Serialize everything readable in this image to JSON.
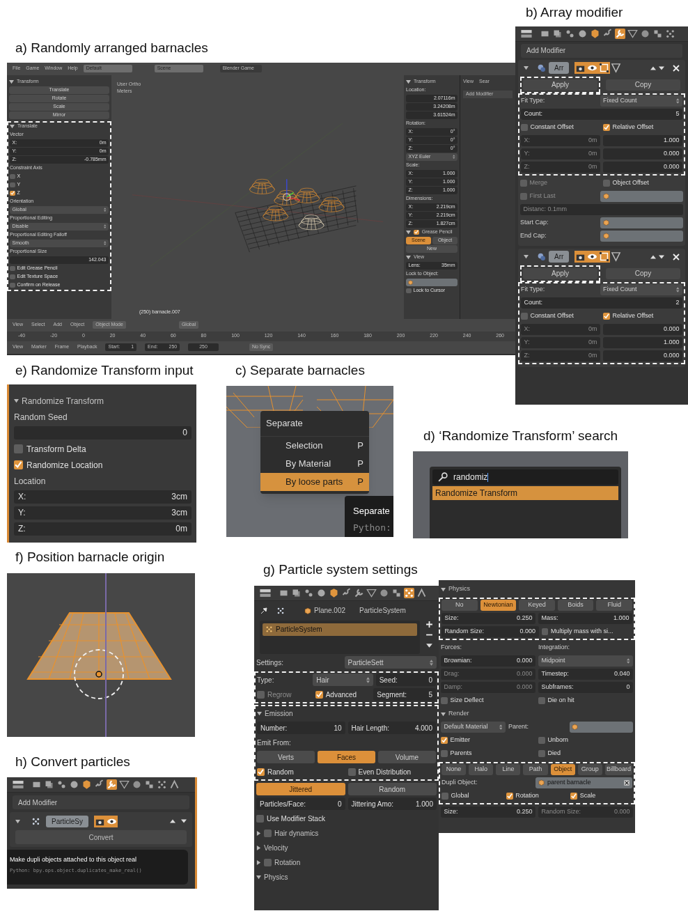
{
  "panel_a": {
    "caption": "a) Randomly arranged barnacles",
    "top_menu": [
      "File",
      "Game",
      "Window",
      "Help"
    ],
    "layout_field": "Default",
    "scene_field": "Scene",
    "engine_field": "Blender Game",
    "tool_shelf": [
      {
        "outlined": false,
        "rows": [
          {
            "items": [
              {
                "kind": "header",
                "label": "Transform",
                "expanded": true
              }
            ]
          },
          {
            "items": [
              {
                "kind": "button",
                "label": "Translate",
                "selected": false
              }
            ]
          },
          {
            "items": [
              {
                "kind": "button",
                "label": "Rotate",
                "selected": false
              }
            ]
          },
          {
            "items": [
              {
                "kind": "button",
                "label": "Scale",
                "selected": false
              }
            ]
          },
          {
            "items": [
              {
                "kind": "button",
                "label": "Mirror",
                "selected": false
              }
            ]
          }
        ]
      },
      {
        "outlined": true,
        "rows": [
          {
            "items": [
              {
                "kind": "header",
                "label": "Translate",
                "expanded": true
              }
            ]
          },
          {
            "items": [
              {
                "kind": "text",
                "label": "Vector"
              }
            ]
          },
          {
            "items": [
              {
                "kind": "field",
                "label": "X:",
                "value": "0m",
                "disabled": false
              }
            ]
          },
          {
            "items": [
              {
                "kind": "field",
                "label": "Y:",
                "value": "0m",
                "disabled": false
              }
            ]
          },
          {
            "items": [
              {
                "kind": "field",
                "label": "Z:",
                "value": "-0.785mm",
                "disabled": false
              }
            ]
          },
          {
            "items": [
              {
                "kind": "text",
                "label": "Constraint Axis"
              }
            ]
          },
          {
            "items": [
              {
                "kind": "check",
                "label": "X",
                "checked": false,
                "disabled": false
              }
            ]
          },
          {
            "items": [
              {
                "kind": "check",
                "label": "Y",
                "checked": false,
                "disabled": false
              }
            ]
          },
          {
            "items": [
              {
                "kind": "check",
                "label": "Z",
                "checked": true,
                "disabled": false
              }
            ]
          },
          {
            "items": [
              {
                "kind": "text",
                "label": "Orientation"
              }
            ]
          },
          {
            "items": [
              {
                "kind": "select",
                "label": "Global"
              }
            ]
          },
          {
            "items": [
              {
                "kind": "text",
                "label": "Proportional Editing"
              }
            ]
          },
          {
            "items": [
              {
                "kind": "select",
                "label": "Disable"
              }
            ]
          },
          {
            "items": [
              {
                "kind": "text",
                "label": "Proportional Editing Falloff"
              }
            ]
          },
          {
            "items": [
              {
                "kind": "select",
                "label": "Smooth"
              }
            ]
          },
          {
            "items": [
              {
                "kind": "text",
                "label": "Proportional Size"
              }
            ]
          },
          {
            "items": [
              {
                "kind": "field",
                "value": "142.043",
                "disabled": false
              }
            ]
          },
          {
            "items": [
              {
                "kind": "check",
                "label": "Edit Grease Pencil",
                "checked": false,
                "disabled": false
              }
            ]
          },
          {
            "items": [
              {
                "kind": "check",
                "label": "Edit Texture Space",
                "checked": false,
                "disabled": false
              }
            ]
          },
          {
            "items": [
              {
                "kind": "check",
                "label": "Confirm on Release",
                "checked": false,
                "disabled": false
              }
            ]
          }
        ]
      }
    ],
    "viewport": {
      "view_name": "User Ortho",
      "units": "Meters",
      "object_label": "(250) barnacle.007"
    },
    "n_panel": [
      {
        "outlined": false,
        "rows": [
          {
            "items": [
              {
                "kind": "header",
                "label": "Transform",
                "expanded": true
              }
            ]
          },
          {
            "items": [
              {
                "kind": "text",
                "label": "Location:"
              }
            ]
          },
          {
            "items": [
              {
                "kind": "field",
                "value": "2.07116m",
                "disabled": false
              }
            ]
          },
          {
            "items": [
              {
                "kind": "field",
                "value": "3.24208m",
                "disabled": false
              }
            ]
          },
          {
            "items": [
              {
                "kind": "field",
                "value": "3.61524m",
                "disabled": false
              }
            ]
          },
          {
            "items": [
              {
                "kind": "text",
                "label": "Rotation:"
              }
            ]
          },
          {
            "items": [
              {
                "kind": "field",
                "label": "X:",
                "value": "0°",
                "disabled": false
              }
            ]
          },
          {
            "items": [
              {
                "kind": "field",
                "label": "Y:",
                "value": "0°",
                "disabled": false
              }
            ]
          },
          {
            "items": [
              {
                "kind": "field",
                "label": "Z:",
                "value": "0°",
                "disabled": false
              }
            ]
          },
          {
            "items": [
              {
                "kind": "select",
                "label": "XYZ Euler"
              }
            ]
          },
          {
            "items": [
              {
                "kind": "text",
                "label": "Scale:"
              }
            ]
          },
          {
            "items": [
              {
                "kind": "field",
                "label": "X:",
                "value": "1.000",
                "disabled": false
              }
            ]
          },
          {
            "items": [
              {
                "kind": "field",
                "label": "Y:",
                "value": "1.000",
                "disabled": false
              }
            ]
          },
          {
            "items": [
              {
                "kind": "field",
                "label": "Z:",
                "value": "1.000",
                "disabled": false
              }
            ]
          },
          {
            "items": [
              {
                "kind": "text",
                "label": "Dimensions:"
              }
            ]
          },
          {
            "items": [
              {
                "kind": "field",
                "label": "X:",
                "value": "2.219cm",
                "disabled": false
              }
            ]
          },
          {
            "items": [
              {
                "kind": "field",
                "label": "Y:",
                "value": "2.219cm",
                "disabled": false
              }
            ]
          },
          {
            "items": [
              {
                "kind": "field",
                "label": "Z:",
                "value": "1.827cm",
                "disabled": false
              }
            ]
          },
          {
            "items": [
              {
                "kind": "header",
                "label": "Grease Pencil",
                "expanded": true,
                "checked": true
              }
            ]
          },
          {
            "items": [
              {
                "kind": "button",
                "label": "Scene",
                "selected": true
              },
              {
                "kind": "button",
                "label": "Object",
                "selected": false
              }
            ]
          },
          {
            "items": [
              {
                "kind": "button",
                "label": "New",
                "selected": false
              }
            ]
          },
          {
            "items": [
              {
                "kind": "header",
                "label": "View",
                "expanded": true
              }
            ]
          },
          {
            "items": [
              {
                "kind": "field",
                "label": "Lens:",
                "value": "35mm",
                "disabled": false
              }
            ]
          },
          {
            "items": [
              {
                "kind": "text",
                "label": "Lock to Object:"
              }
            ]
          },
          {
            "items": [
              {
                "kind": "object"
              }
            ]
          },
          {
            "items": [
              {
                "kind": "check",
                "label": "Lock to Cursor",
                "checked": false,
                "disabled": false
              }
            ]
          }
        ]
      }
    ],
    "side_tabs": [
      "View",
      "Sear"
    ],
    "side_add_modifier": "Add Modifier",
    "view_header": {
      "menus": [
        "View",
        "Select",
        "Add",
        "Object"
      ],
      "mode": "Object Mode",
      "orientation": "Global"
    },
    "timeline_ticks": [
      "-40",
      "-20",
      "0",
      "20",
      "40",
      "60",
      "80",
      "100",
      "120",
      "140",
      "160",
      "180",
      "200",
      "220",
      "240",
      "260"
    ],
    "timeline_header": {
      "menus": [
        "View",
        "Marker",
        "Frame",
        "Playback"
      ],
      "start": "Start:",
      "start_value": "1",
      "end": "End:",
      "end_value": "250",
      "current": "250",
      "sync": "No Sync"
    }
  },
  "panel_b": {
    "caption": "b) Array modifier",
    "tabs": [
      {
        "kind": "render",
        "selected": false
      },
      {
        "kind": "layers",
        "selected": false
      },
      {
        "kind": "scene",
        "selected": false
      },
      {
        "kind": "world",
        "selected": false
      },
      {
        "kind": "object",
        "selected": false
      },
      {
        "kind": "constraints",
        "selected": false
      },
      {
        "kind": "modifiers",
        "selected": true
      },
      {
        "kind": "data",
        "selected": false
      },
      {
        "kind": "material",
        "selected": false
      },
      {
        "kind": "texture",
        "selected": false
      },
      {
        "kind": "particles",
        "selected": false
      }
    ],
    "add_modifier": "Add Modifier",
    "modifiers": [
      {
        "name": "Arr",
        "toggles": [
          {
            "kind": "render",
            "on": true
          },
          {
            "kind": "viewport",
            "on": true
          },
          {
            "kind": "editmode",
            "on": true
          },
          {
            "kind": "cage",
            "on": false
          }
        ],
        "apply": "Apply",
        "apply_outlined": true,
        "copy": "Copy",
        "sections": [
          {
            "outlined": true,
            "rows": [
              {
                "items": [
                  {
                    "kind": "text",
                    "label": "Fit Type:"
                  },
                  {
                    "kind": "select",
                    "label": "Fixed Count"
                  }
                ]
              },
              {
                "items": [
                  {
                    "kind": "field",
                    "label": "Count:",
                    "value": "5",
                    "disabled": false
                  }
                ]
              },
              {
                "items": [
                  {
                    "kind": "check",
                    "label": "Constant Offset",
                    "checked": false,
                    "disabled": false
                  },
                  {
                    "kind": "check",
                    "label": "Relative Offset",
                    "checked": true,
                    "disabled": false
                  }
                ]
              },
              {
                "items": [
                  {
                    "kind": "field",
                    "label": "X:",
                    "value": "0m",
                    "disabled": true
                  },
                  {
                    "kind": "field",
                    "value": "1.000",
                    "disabled": false
                  }
                ]
              },
              {
                "items": [
                  {
                    "kind": "field",
                    "label": "Y:",
                    "value": "0m",
                    "disabled": true
                  },
                  {
                    "kind": "field",
                    "value": "0.000",
                    "disabled": false
                  }
                ]
              },
              {
                "items": [
                  {
                    "kind": "field",
                    "label": "Z:",
                    "value": "0m",
                    "disabled": true
                  },
                  {
                    "kind": "field",
                    "value": "0.000",
                    "disabled": false
                  }
                ]
              }
            ]
          },
          {
            "outlined": false,
            "rows": [
              {
                "items": [
                  {
                    "kind": "check",
                    "label": "Merge",
                    "checked": false,
                    "disabled": true
                  },
                  {
                    "kind": "check",
                    "label": "Object Offset",
                    "checked": false,
                    "disabled": false
                  }
                ]
              },
              {
                "items": [
                  {
                    "kind": "check",
                    "label": "First Last",
                    "checked": false,
                    "disabled": true
                  },
                  {
                    "kind": "object"
                  }
                ]
              },
              {
                "items": [
                  {
                    "kind": "field",
                    "label": "Distanc: 0.1mm",
                    "disabled": true
                  }
                ]
              },
              {
                "items": [
                  {
                    "kind": "text",
                    "label": "Start Cap:"
                  },
                  {
                    "kind": "object"
                  }
                ]
              },
              {
                "items": [
                  {
                    "kind": "text",
                    "label": "End Cap:"
                  },
                  {
                    "kind": "object"
                  }
                ]
              }
            ]
          }
        ]
      },
      {
        "name": "Arr",
        "toggles": [
          {
            "kind": "render",
            "on": true
          },
          {
            "kind": "viewport",
            "on": true
          },
          {
            "kind": "editmode",
            "on": true
          },
          {
            "kind": "cage",
            "on": false
          }
        ],
        "apply": "Apply",
        "apply_outlined": true,
        "copy": "Copy",
        "sections": [
          {
            "outlined": true,
            "rows": [
              {
                "items": [
                  {
                    "kind": "text",
                    "label": "Fit Type:"
                  },
                  {
                    "kind": "select",
                    "label": "Fixed Count"
                  }
                ]
              },
              {
                "items": [
                  {
                    "kind": "field",
                    "label": "Count:",
                    "value": "2",
                    "disabled": false
                  }
                ]
              },
              {
                "items": [
                  {
                    "kind": "check",
                    "label": "Constant Offset",
                    "checked": false,
                    "disabled": false
                  },
                  {
                    "kind": "check",
                    "label": "Relative Offset",
                    "checked": true,
                    "disabled": false
                  }
                ]
              },
              {
                "items": [
                  {
                    "kind": "field",
                    "label": "X:",
                    "value": "0m",
                    "disabled": true
                  },
                  {
                    "kind": "field",
                    "value": "0.000",
                    "disabled": false
                  }
                ]
              },
              {
                "items": [
                  {
                    "kind": "field",
                    "label": "Y:",
                    "value": "0m",
                    "disabled": true
                  },
                  {
                    "kind": "field",
                    "value": "1.000",
                    "disabled": false
                  }
                ]
              },
              {
                "items": [
                  {
                    "kind": "field",
                    "label": "Z:",
                    "value": "0m",
                    "disabled": true
                  },
                  {
                    "kind": "field",
                    "value": "0.000",
                    "disabled": false
                  }
                ]
              }
            ]
          }
        ]
      }
    ]
  },
  "panel_e": {
    "caption": "e) Randomize Transform  input",
    "sections": [
      {
        "outlined": false,
        "rows": [
          {
            "items": [
              {
                "kind": "header",
                "label": "Randomize Transform",
                "expanded": true
              }
            ]
          },
          {
            "items": [
              {
                "kind": "text",
                "label": "Random Seed"
              }
            ]
          },
          {
            "items": [
              {
                "kind": "field",
                "value": "0",
                "disabled": false
              }
            ]
          },
          {
            "items": [
              {
                "kind": "check",
                "label": "Transform Delta",
                "checked": false,
                "disabled": false
              }
            ]
          },
          {
            "items": [
              {
                "kind": "check",
                "label": "Randomize Location",
                "checked": true,
                "disabled": false
              }
            ]
          },
          {
            "items": [
              {
                "kind": "text",
                "label": "Location"
              }
            ]
          },
          {
            "items": [
              {
                "kind": "field",
                "label": "X:",
                "value": "3cm",
                "disabled": false
              }
            ]
          },
          {
            "items": [
              {
                "kind": "field",
                "label": "Y:",
                "value": "3cm",
                "disabled": false
              }
            ]
          },
          {
            "items": [
              {
                "kind": "field",
                "label": "Z:",
                "value": "0m",
                "disabled": false
              }
            ]
          }
        ]
      }
    ]
  },
  "panel_c": {
    "caption": "c) Separate barnacles",
    "menu_title": "Separate",
    "menu_items": [
      {
        "label": "Selection",
        "shortcut": "P",
        "selected": false
      },
      {
        "label": "By Material",
        "shortcut": "P",
        "selected": false
      },
      {
        "label": "By loose parts",
        "shortcut": "P",
        "selected": true
      }
    ],
    "tooltip_title": "Separate",
    "tooltip_python": "Python:"
  },
  "panel_d": {
    "caption": "d) ‘Randomize Transform’  search",
    "search_value": "randomiz",
    "results": [
      {
        "label": "Randomize Transform",
        "selected": true
      }
    ]
  },
  "panel_f": {
    "caption": "f) Position barnacle origin"
  },
  "panel_h": {
    "caption": "h) Convert  particles",
    "tabs": [
      {
        "kind": "render",
        "selected": false
      },
      {
        "kind": "layers",
        "selected": false
      },
      {
        "kind": "scene",
        "selected": false
      },
      {
        "kind": "world",
        "selected": false
      },
      {
        "kind": "object",
        "selected": false
      },
      {
        "kind": "constraints",
        "selected": false
      },
      {
        "kind": "modifiers",
        "selected": true
      },
      {
        "kind": "data",
        "selected": false
      },
      {
        "kind": "material",
        "selected": false
      },
      {
        "kind": "texture",
        "selected": false
      },
      {
        "kind": "particles",
        "selected": false
      },
      {
        "kind": "physics",
        "selected": false
      }
    ],
    "add_modifier": "Add Modifier",
    "modifier_name": "ParticleSy",
    "toggles": [
      {
        "kind": "render",
        "on": true
      },
      {
        "kind": "viewport",
        "on": true
      }
    ],
    "convert": "Convert",
    "tooltip_title": "Make dupli objects attached to this object real",
    "tooltip_python": "Python: bpy.ops.object.duplicates_make_real()"
  },
  "panel_g": {
    "caption": "g) Particle system settings",
    "tabs": [
      {
        "kind": "render",
        "selected": false
      },
      {
        "kind": "layers",
        "selected": false
      },
      {
        "kind": "scene",
        "selected": false
      },
      {
        "kind": "world",
        "selected": false
      },
      {
        "kind": "object",
        "selected": false
      },
      {
        "kind": "constraints",
        "selected": false
      },
      {
        "kind": "modifiers",
        "selected": false
      },
      {
        "kind": "data",
        "selected": false
      },
      {
        "kind": "material",
        "selected": false
      },
      {
        "kind": "texture",
        "selected": false
      },
      {
        "kind": "particles",
        "selected": true
      },
      {
        "kind": "physics",
        "selected": false
      }
    ],
    "object_name": "Plane.002",
    "system_name": "ParticleSystem",
    "list_item": "ParticleSystem",
    "left_sections": [
      {
        "outlined": false,
        "rows": [
          {
            "items": [
              {
                "kind": "text",
                "label": "Settings:"
              },
              {
                "kind": "select",
                "label": "ParticleSett"
              }
            ]
          }
        ]
      },
      {
        "outlined": true,
        "rows": [
          {
            "items": [
              {
                "kind": "text",
                "label": "Type:"
              },
              {
                "kind": "select",
                "label": "Hair"
              },
              {
                "kind": "field",
                "label": "Seed:",
                "value": "0",
                "disabled": false
              }
            ]
          },
          {
            "items": [
              {
                "kind": "check",
                "label": "Regrow",
                "checked": false,
                "disabled": true
              },
              {
                "kind": "check",
                "label": "Advanced",
                "checked": true,
                "disabled": false
              },
              {
                "kind": "field",
                "label": "Segment:",
                "value": "5",
                "disabled": false
              }
            ]
          }
        ]
      },
      {
        "outlined": true,
        "rows": [
          {
            "items": [
              {
                "kind": "header",
                "label": "Emission",
                "expanded": true
              }
            ]
          },
          {
            "items": [
              {
                "kind": "field",
                "label": "Number:",
                "value": "10",
                "disabled": false
              },
              {
                "kind": "field",
                "label": "Hair Length:",
                "value": "4.000",
                "disabled": false
              }
            ]
          },
          {
            "items": [
              {
                "kind": "text",
                "label": "Emit From:"
              }
            ]
          },
          {
            "items": [
              {
                "kind": "button",
                "label": "Verts",
                "selected": false
              },
              {
                "kind": "button",
                "label": "Faces",
                "selected": true
              },
              {
                "kind": "button",
                "label": "Volume",
                "selected": false
              }
            ]
          },
          {
            "items": [
              {
                "kind": "check",
                "label": "Random",
                "checked": true,
                "disabled": false
              },
              {
                "kind": "check",
                "label": "Even Distribution",
                "checked": false,
                "disabled": false
              }
            ]
          }
        ]
      },
      {
        "outlined": false,
        "rows": [
          {
            "items": [
              {
                "kind": "button",
                "label": "Jittered",
                "selected": true
              },
              {
                "kind": "button",
                "label": "Random",
                "selected": false
              }
            ]
          },
          {
            "items": [
              {
                "kind": "field",
                "label": "Particles/Face:",
                "value": "0",
                "disabled": false
              },
              {
                "kind": "field",
                "label": "Jittering Amo:",
                "value": "1.000",
                "disabled": false
              }
            ]
          },
          {
            "items": [
              {
                "kind": "check",
                "label": "Use Modifier Stack",
                "checked": false,
                "disabled": false
              }
            ]
          },
          {
            "items": [
              {
                "kind": "header",
                "label": "Hair dynamics",
                "expanded": false,
                "checked": false
              }
            ]
          },
          {
            "items": [
              {
                "kind": "header",
                "label": "Velocity",
                "expanded": false
              }
            ]
          },
          {
            "items": [
              {
                "kind": "header",
                "label": "Rotation",
                "expanded": false,
                "checked": false
              }
            ]
          },
          {
            "items": [
              {
                "kind": "header",
                "label": "Physics",
                "expanded": true
              }
            ]
          }
        ]
      }
    ],
    "right_sections": [
      {
        "outlined": false,
        "rows": [
          {
            "items": [
              {
                "kind": "header",
                "label": "Physics",
                "expanded": true
              }
            ]
          }
        ]
      },
      {
        "outlined": true,
        "rows": [
          {
            "items": [
              {
                "kind": "button",
                "label": "No",
                "selected": false
              },
              {
                "kind": "button",
                "label": "Newtonian",
                "selected": true
              },
              {
                "kind": "button",
                "label": "Keyed",
                "selected": false
              },
              {
                "kind": "button",
                "label": "Boids",
                "selected": false
              },
              {
                "kind": "button",
                "label": "Fluid",
                "selected": false
              }
            ]
          },
          {
            "items": [
              {
                "kind": "field",
                "label": "Size:",
                "value": "0.250",
                "disabled": false
              },
              {
                "kind": "field",
                "label": "Mass:",
                "value": "1.000",
                "disabled": false
              }
            ]
          },
          {
            "items": [
              {
                "kind": "field",
                "label": "Random Size:",
                "value": "0.000",
                "disabled": false
              },
              {
                "kind": "check",
                "label": "Multiply mass with si...",
                "checked": false,
                "disabled": false
              }
            ]
          }
        ]
      },
      {
        "outlined": false,
        "rows": [
          {
            "items": [
              {
                "kind": "text",
                "label": "Forces:"
              },
              {
                "kind": "text",
                "label": "Integration:"
              }
            ]
          },
          {
            "items": [
              {
                "kind": "field",
                "label": "Brownian:",
                "value": "0.000",
                "disabled": false
              },
              {
                "kind": "select",
                "label": "Midpoint"
              }
            ]
          },
          {
            "items": [
              {
                "kind": "field",
                "label": "Drag:",
                "value": "0.000",
                "disabled": true
              },
              {
                "kind": "field",
                "label": "Timestep:",
                "value": "0.040",
                "disabled": false
              }
            ]
          },
          {
            "items": [
              {
                "kind": "field",
                "label": "Damp:",
                "value": "0.000",
                "disabled": true
              },
              {
                "kind": "field",
                "label": "Subframes:",
                "value": "0",
                "disabled": false
              }
            ]
          },
          {
            "items": [
              {
                "kind": "check",
                "label": "Size Deflect",
                "checked": false,
                "disabled": false
              },
              {
                "kind": "check",
                "label": "Die on hit",
                "checked": false,
                "disabled": false
              }
            ]
          },
          {
            "items": [
              {
                "kind": "header",
                "label": "Render",
                "expanded": true
              }
            ]
          },
          {
            "items": [
              {
                "kind": "select",
                "label": "Default Material"
              },
              {
                "kind": "text",
                "label": "Parent:"
              },
              {
                "kind": "object"
              }
            ]
          },
          {
            "items": [
              {
                "kind": "check",
                "label": "Emitter",
                "checked": true,
                "disabled": false
              },
              {
                "kind": "check",
                "label": "Unborn",
                "checked": false,
                "disabled": false
              }
            ]
          },
          {
            "items": [
              {
                "kind": "check",
                "label": "Parents",
                "checked": false,
                "disabled": false
              },
              {
                "kind": "check",
                "label": "Died",
                "checked": false,
                "disabled": false
              }
            ]
          }
        ]
      },
      {
        "outlined": true,
        "rows": [
          {
            "items": [
              {
                "kind": "button",
                "label": "None",
                "selected": false
              },
              {
                "kind": "button",
                "label": "Halo",
                "selected": false
              },
              {
                "kind": "button",
                "label": "Line",
                "selected": false
              },
              {
                "kind": "button",
                "label": "Path",
                "selected": false
              },
              {
                "kind": "button",
                "label": "Object",
                "selected": true
              },
              {
                "kind": "button",
                "label": "Group",
                "selected": false
              },
              {
                "kind": "button",
                "label": "Billboard",
                "selected": false
              }
            ]
          },
          {
            "items": [
              {
                "kind": "text",
                "label": "Dupli Object:"
              },
              {
                "kind": "object",
                "value": "parent barnacle"
              }
            ]
          },
          {
            "items": [
              {
                "kind": "check",
                "label": "Global",
                "checked": false,
                "disabled": false
              },
              {
                "kind": "check",
                "label": "Rotation",
                "checked": true,
                "disabled": false
              },
              {
                "kind": "check",
                "label": "Scale",
                "checked": true,
                "disabled": false
              }
            ]
          }
        ]
      },
      {
        "outlined": false,
        "rows": [
          {
            "items": [
              {
                "kind": "field",
                "label": "Size:",
                "value": "0.250",
                "disabled": false
              },
              {
                "kind": "field",
                "label": "Random Size:",
                "value": "0.000",
                "disabled": true
              }
            ]
          }
        ]
      }
    ]
  }
}
